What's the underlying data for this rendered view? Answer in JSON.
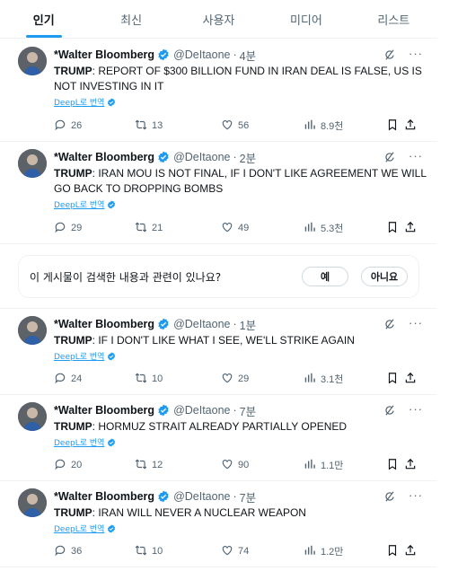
{
  "tabs": [
    {
      "label": "인기",
      "active": true
    },
    {
      "label": "최신",
      "active": false
    },
    {
      "label": "사용자",
      "active": false
    },
    {
      "label": "미디어",
      "active": false
    },
    {
      "label": "리스트",
      "active": false
    }
  ],
  "accent_color": "#1d9bf0",
  "icons": {
    "reply": "reply-icon",
    "retweet": "retweet-icon",
    "like": "like-icon",
    "views": "views-icon",
    "bookmark": "bookmark-icon",
    "share": "share-icon",
    "verified": "verified-badge-icon",
    "grok": "grok-icon",
    "more": "more-icon"
  },
  "tweets": [
    {
      "name": "*Walter Bloomberg",
      "handle": "@DeItaone",
      "dot": "·",
      "time": "4분",
      "prefix": "TRUMP",
      "body": ": REPORT OF $300 BILLION FUND IN IRAN DEAL IS FALSE, US IS NOT INVESTING IN IT",
      "translate": "DeepL로 번역",
      "replies": "26",
      "retweets": "13",
      "likes": "56",
      "views": "8.9천"
    },
    {
      "name": "*Walter Bloomberg",
      "handle": "@DeItaone",
      "dot": "·",
      "time": "2분",
      "prefix": "TRUMP",
      "body": ": IRAN MOU IS NOT FINAL, IF I DON'T LIKE AGREEMENT WE WILL GO BACK TO DROPPING BOMBS",
      "translate": "DeepL로 번역",
      "replies": "29",
      "retweets": "21",
      "likes": "49",
      "views": "5.3천"
    },
    {
      "name": "*Walter Bloomberg",
      "handle": "@DeItaone",
      "dot": "·",
      "time": "1분",
      "prefix": "TRUMP",
      "body": ": IF I DON'T LIKE WHAT I SEE, WE'LL STRIKE AGAIN",
      "translate": "DeepL로 번역",
      "replies": "24",
      "retweets": "10",
      "likes": "29",
      "views": "3.1천"
    },
    {
      "name": "*Walter Bloomberg",
      "handle": "@DeItaone",
      "dot": "·",
      "time": "7분",
      "prefix": "TRUMP",
      "body": ": HORMUZ STRAIT ALREADY PARTIALLY OPENED",
      "translate": "DeepL로 번역",
      "replies": "20",
      "retweets": "12",
      "likes": "90",
      "views": "1.1만"
    },
    {
      "name": "*Walter Bloomberg",
      "handle": "@DeItaone",
      "dot": "·",
      "time": "7분",
      "prefix": "TRUMP",
      "body": ": IRAN WILL NEVER A NUCLEAR WEAPON",
      "translate": "DeepL로 번역",
      "replies": "36",
      "retweets": "10",
      "likes": "74",
      "views": "1.2만"
    }
  ],
  "survey": {
    "question": "이 게시물이 검색한 내용과 관련이 있나요?",
    "yes_label": "예",
    "no_label": "아니요"
  }
}
